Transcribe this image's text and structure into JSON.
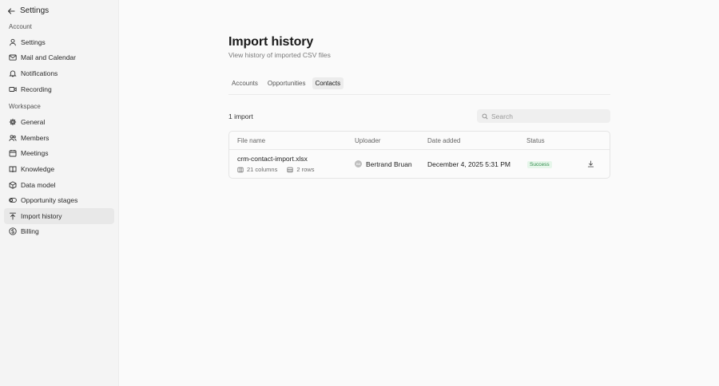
{
  "sidebar": {
    "title": "Settings",
    "account_label": "Account",
    "workspace_label": "Workspace",
    "account_items": [
      {
        "label": "Settings",
        "icon": "user-icon"
      },
      {
        "label": "Mail and Calendar",
        "icon": "mail-icon"
      },
      {
        "label": "Notifications",
        "icon": "bell-icon"
      },
      {
        "label": "Recording",
        "icon": "video-icon"
      }
    ],
    "workspace_items": [
      {
        "label": "General",
        "icon": "gear-icon"
      },
      {
        "label": "Members",
        "icon": "users-icon"
      },
      {
        "label": "Meetings",
        "icon": "calendar-icon"
      },
      {
        "label": "Knowledge",
        "icon": "book-icon"
      },
      {
        "label": "Data model",
        "icon": "cube-icon"
      },
      {
        "label": "Opportunity stages",
        "icon": "toggle-icon"
      },
      {
        "label": "Import history",
        "icon": "upload-icon",
        "active": true
      },
      {
        "label": "Billing",
        "icon": "dollar-icon"
      }
    ]
  },
  "page": {
    "title": "Import history",
    "subtitle": "View history of imported CSV files"
  },
  "tabs": [
    {
      "label": "Accounts"
    },
    {
      "label": "Opportunities"
    },
    {
      "label": "Contacts",
      "active": true
    }
  ],
  "toolbar": {
    "count_text": "1 import",
    "search_placeholder": "Search"
  },
  "table": {
    "headers": [
      "File name",
      "Uploader",
      "Date added",
      "Status"
    ],
    "rows": [
      {
        "file_name": "crm-contact-import.xlsx",
        "columns": "21 columns",
        "rows": "2 rows",
        "uploader": "Bertrand Bruan",
        "avatar_initials": "BB",
        "date": "December 4, 2025 5:31 PM",
        "status": "Success"
      }
    ]
  },
  "colors": {
    "active_nav_bg": "#e8e8e8",
    "success_text": "#2e8b4a",
    "success_bg": "#e6f6ea"
  }
}
